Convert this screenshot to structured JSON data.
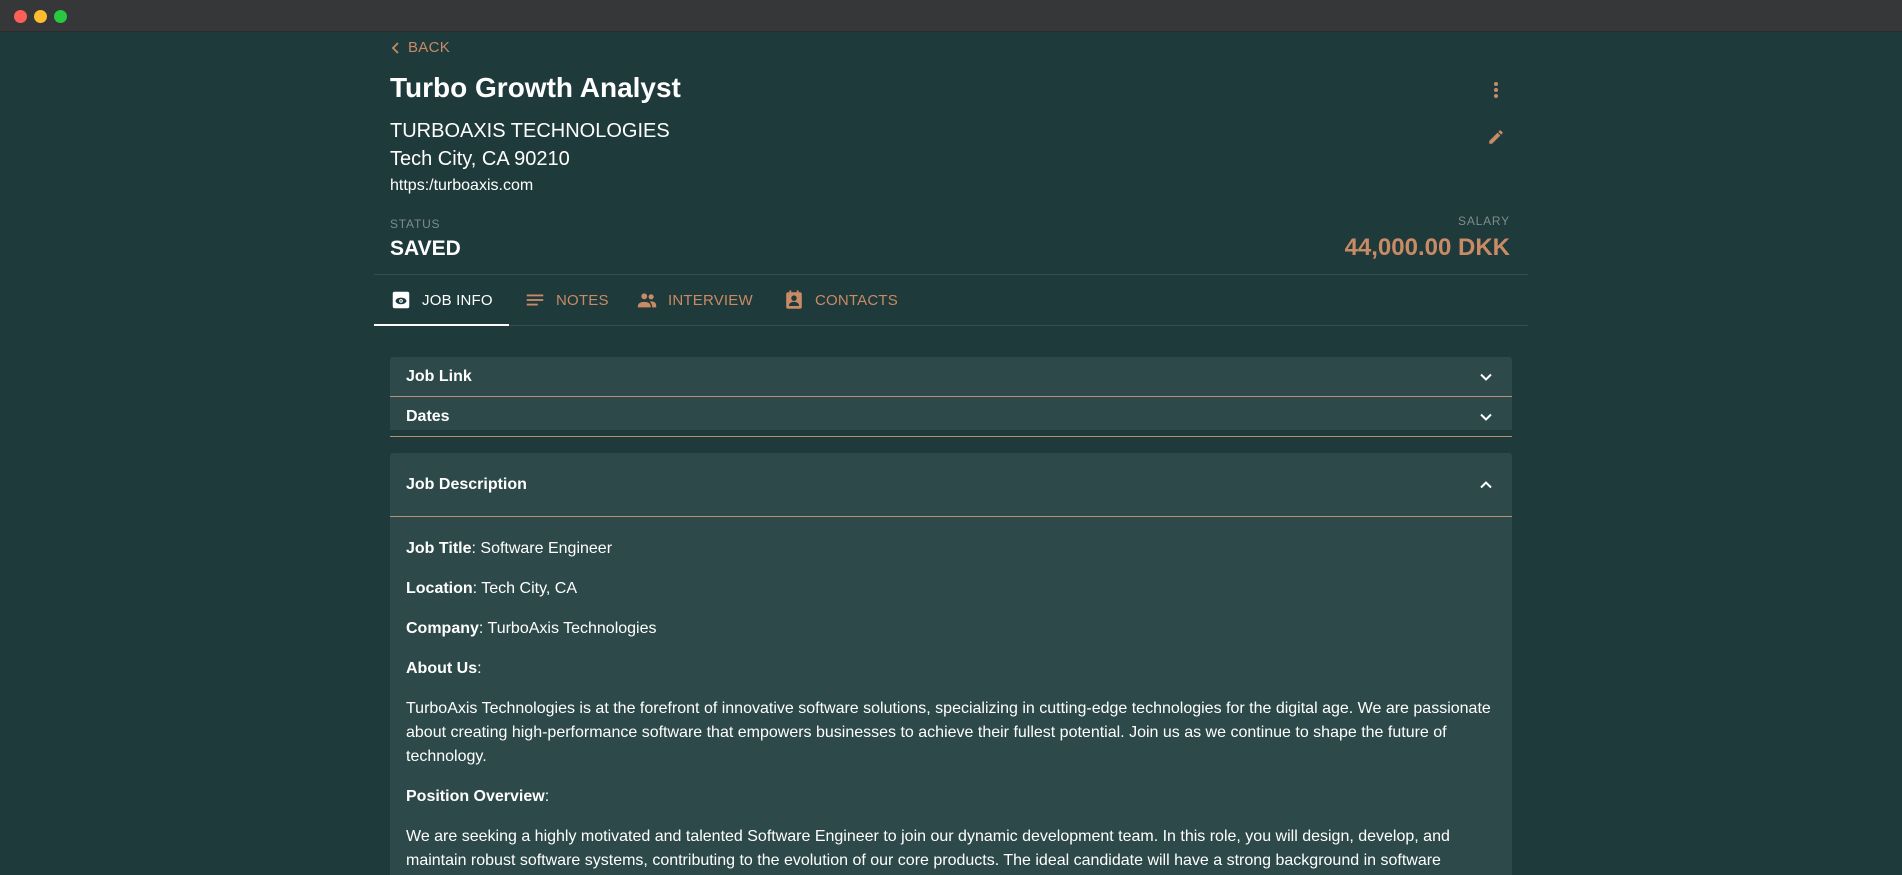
{
  "header": {
    "back_label": "BACK",
    "job_title": "Turbo Growth Analyst",
    "company": "TURBOAXIS TECHNOLOGIES",
    "city": "Tech City, CA 90210",
    "website": "https:/turboaxis.com"
  },
  "status": {
    "label": "STATUS",
    "value": "SAVED"
  },
  "salary": {
    "label": "SALARY",
    "value": "44,000.00 DKK"
  },
  "tabs": [
    {
      "label": "JOB INFO",
      "icon": "eye-badge-icon",
      "active": true
    },
    {
      "label": "NOTES",
      "icon": "notes-lines-icon",
      "active": false
    },
    {
      "label": "INTERVIEW",
      "icon": "people-icon",
      "active": false
    },
    {
      "label": "CONTACTS",
      "icon": "contact-card-icon",
      "active": false
    }
  ],
  "sections": {
    "job_link": "Job Link",
    "dates": "Dates",
    "job_description": "Job Description"
  },
  "description": {
    "job_title_label": "Job Title",
    "job_title_value": ": Software Engineer",
    "location_label": "Location",
    "location_value": ": Tech City, CA",
    "company_label": "Company",
    "company_value": ": TurboAxis Technologies",
    "about_label": "About Us",
    "about_colon": ":",
    "about_text": "TurboAxis Technologies is at the forefront of innovative software solutions, specializing in cutting-edge technologies for the digital age. We are passionate about creating high-performance software that empowers businesses to achieve their fullest potential. Join us as we continue to shape the future of technology.",
    "overview_label": "Position Overview",
    "overview_colon": ":",
    "overview_text": "We are seeking a highly motivated and talented Software Engineer to join our dynamic development team. In this role, you will design, develop, and maintain robust software systems, contributing to the evolution of our core products. The ideal candidate will have a strong background in software"
  },
  "colors": {
    "background": "#1f3a3b",
    "panel": "#2d4949",
    "accent": "#c98a66",
    "text": "#ffffff",
    "muted": "#7e8c8c"
  }
}
